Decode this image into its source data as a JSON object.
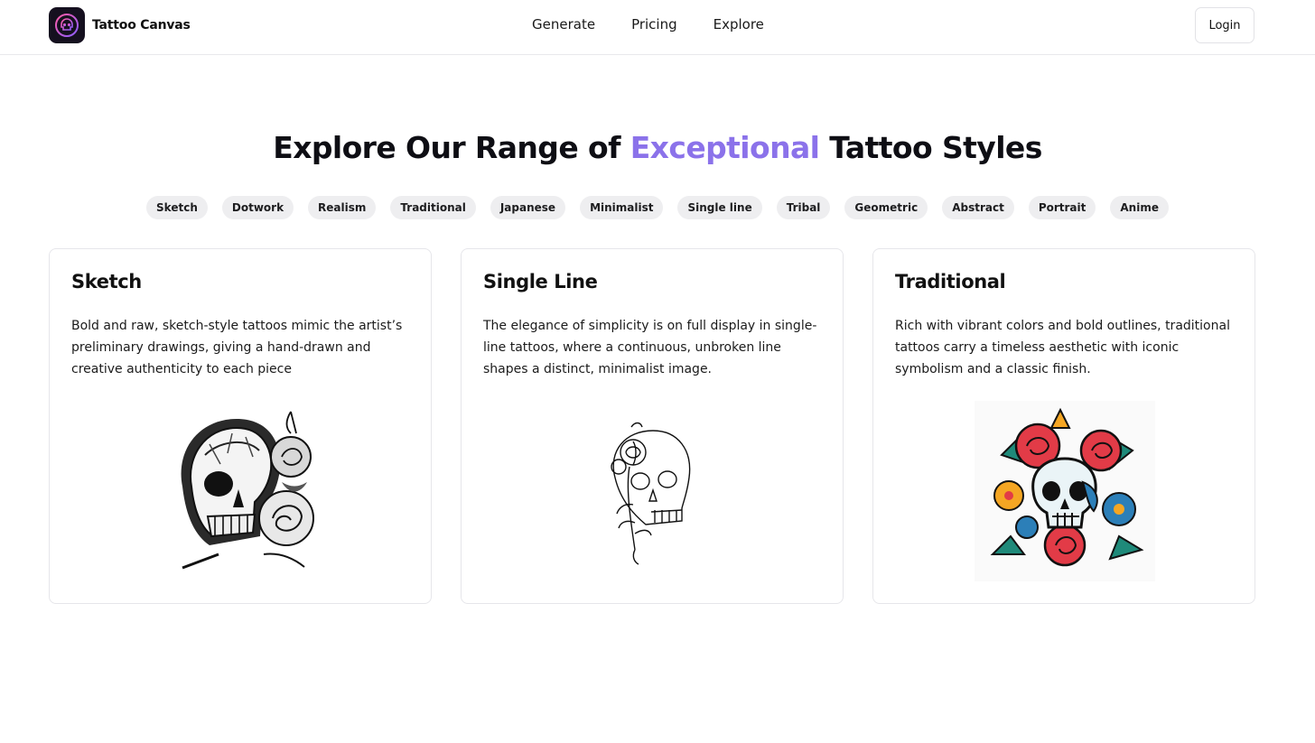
{
  "header": {
    "brand_name": "Tattoo Canvas",
    "logo_icon": "skull-logo-icon",
    "nav": [
      "Generate",
      "Pricing",
      "Explore"
    ],
    "login_label": "Login"
  },
  "heading": {
    "part1": "Explore Our Range of ",
    "accent": "Exceptional",
    "part2": " Tattoo Styles",
    "accent_color": "#8b72ea"
  },
  "styles": [
    "Sketch",
    "Dotwork",
    "Realism",
    "Traditional",
    "Japanese",
    "Minimalist",
    "Single line",
    "Tribal",
    "Geometric",
    "Abstract",
    "Portrait",
    "Anime"
  ],
  "cards": [
    {
      "title": "Sketch",
      "description": "Bold and raw, sketch-style tattoos mimic the artist’s preliminary drawings, giving a hand-drawn and creative authenticity to each piece",
      "image": "sketch-skull-roses-image"
    },
    {
      "title": "Single Line",
      "description": "The elegance of simplicity is on full display in single-line tattoos, where a continuous, unbroken line shapes a distinct, minimalist image.",
      "image": "line-art-skull-flower-image"
    },
    {
      "title": "Traditional",
      "description": "Rich with vibrant colors and bold outlines, traditional tattoos carry a timeless aesthetic with iconic symbolism and a classic finish.",
      "image": "traditional-skull-roses-image"
    }
  ]
}
